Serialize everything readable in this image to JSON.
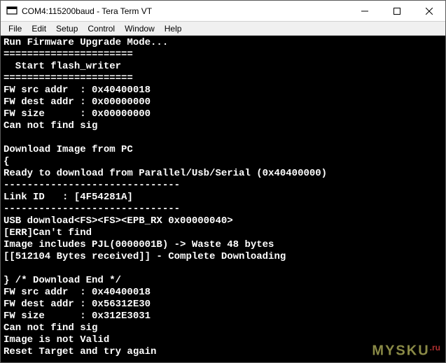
{
  "window": {
    "title": "COM4:115200baud - Tera Term VT"
  },
  "menu": {
    "file": "File",
    "edit": "Edit",
    "setup": "Setup",
    "control": "Control",
    "window": "Window",
    "help": "Help"
  },
  "terminal": {
    "lines": [
      "Run Firmware Upgrade Mode...",
      "======================",
      "  Start flash_writer",
      "======================",
      "FW src addr  : 0x40400018",
      "FW dest addr : 0x00000000",
      "FW size      : 0x00000000",
      "Can not find sig",
      "",
      "Download Image from PC",
      "{",
      "Ready to download from Parallel/Usb/Serial (0x40400000)",
      "------------------------------",
      "Link ID   : [4F54281A]",
      "------------------------------",
      "USB download<FS><FS><EPB_RX 0x00000040>",
      "[ERR]Can't find",
      "Image includes PJL(0000001B) -> Waste 48 bytes",
      "[[512104 Bytes received]] - Complete Downloading",
      "",
      "} /* Download End */",
      "FW src addr  : 0x40400018",
      "FW dest addr : 0x56312E30",
      "FW size      : 0x312E3031",
      "Can not find sig",
      "Image is not Valid",
      "Reset Target and try again"
    ]
  },
  "watermark": {
    "main": "MYSKU",
    "suffix": ".ru"
  }
}
